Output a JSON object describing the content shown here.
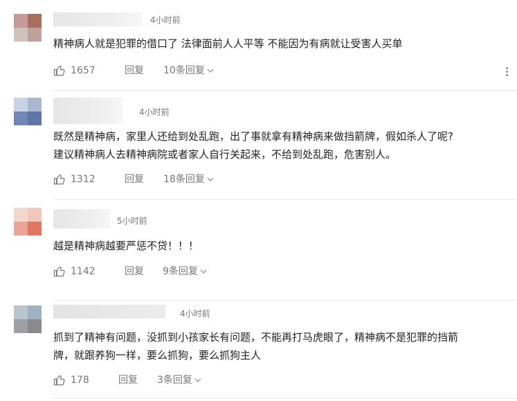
{
  "comments": [
    {
      "time": "4小时前",
      "lines": [
        "精神病人就是犯罪的借口了 法律面前人人平等 不能因为有病就让受害人买单"
      ],
      "likes": "1657",
      "reply_label": "回复",
      "replies_label": "10条回复",
      "avatar_colors": [
        "#c79a9a",
        "#a6705f",
        "#cfc2bc",
        "#bba39b"
      ]
    },
    {
      "time": "4小时前",
      "lines": [
        "既然是精神病，家里人还给到处乱跑，出了事就拿有精神病来做挡箭牌，假如杀人了呢?",
        "建议精神病人去精神病院或者家人自行关起来，不给到处乱跑，危害别人。"
      ],
      "likes": "1312",
      "reply_label": "回复",
      "replies_label": "18条回复",
      "avatar_colors": [
        "#c9d3e6",
        "#aab7d3",
        "#6f89b7",
        "#5f76a6"
      ]
    },
    {
      "time": "5小时前",
      "lines": [
        "越是精神病越要严惩不贷！！！"
      ],
      "likes": "1142",
      "reply_label": "回复",
      "replies_label": "9条回复",
      "avatar_colors": [
        "#f3d8cf",
        "#f0c8bd",
        "#eba596",
        "#e07562"
      ]
    },
    {
      "time": "4小时前",
      "lines": [
        "抓到了精神有问题，没抓到小孩家长有问题，不能再打马虎眼了，精神病不是犯罪的挡箭",
        "牌，就跟养狗一样，要么抓狗，要么抓狗主人"
      ],
      "likes": "178",
      "reply_label": "回复",
      "replies_label": "3条回复",
      "avatar_colors": [
        "#b9c6cf",
        "#9fb2c2",
        "#9d9fa4",
        "#8a8a8e"
      ]
    }
  ],
  "icons": {
    "like": "thumbs-up-icon",
    "expand": "chevron-down-icon",
    "more": "more-vertical-icon"
  },
  "colors": {
    "text": "#222222",
    "meta": "#777777",
    "divider": "#e8e8e8"
  }
}
